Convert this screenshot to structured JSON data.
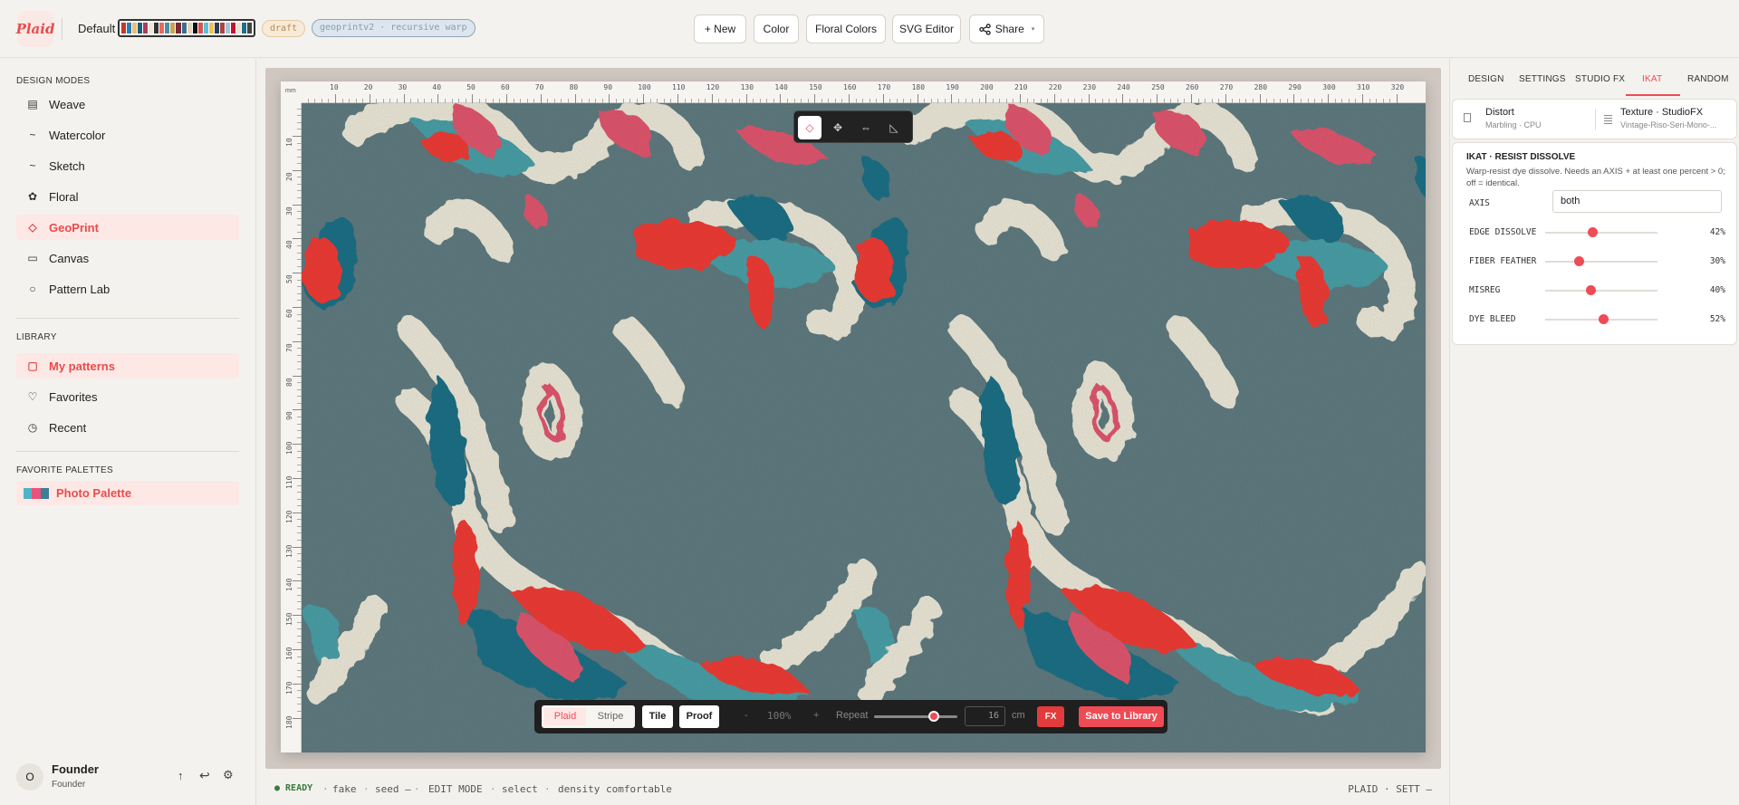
{
  "app": {
    "logo_text": "Plaid"
  },
  "topbar": {
    "project_name": "Default",
    "swatch_colors": [
      "#c0392b",
      "#2980b9",
      "#e8c07a",
      "#1a5e7a",
      "#b03a5b",
      "#f0e6d2",
      "#333333",
      "#e86a5a",
      "#4b8fa8",
      "#c7a35a",
      "#7a2a3a",
      "#3b6e8f",
      "#e5d3b3",
      "#111111",
      "#d9534f",
      "#5bc0de",
      "#f2c14e",
      "#2c3e50",
      "#a94442",
      "#9fc7d6",
      "#c8102e",
      "#eee3cf",
      "#1d6f8a",
      "#444444"
    ],
    "draft_badge": "draft",
    "engine_badge": "geoprintv2 · recursive warp",
    "buttons": {
      "new": "+ New",
      "color": "Color",
      "floral_colors": "Floral Colors",
      "svg_editor": "SVG Editor",
      "share": "Share"
    }
  },
  "sidebar": {
    "design_modes_title": "DESIGN MODES",
    "modes": [
      {
        "label": "Weave",
        "icon": "weave-icon"
      },
      {
        "label": "Watercolor",
        "icon": "watercolor-icon"
      },
      {
        "label": "Sketch",
        "icon": "sketch-icon"
      },
      {
        "label": "Floral",
        "icon": "floral-icon"
      },
      {
        "label": "GeoPrint",
        "icon": "geoprint-icon",
        "active": true
      },
      {
        "label": "Canvas",
        "icon": "canvas-icon"
      },
      {
        "label": "Pattern Lab",
        "icon": "pattern-lab-icon"
      }
    ],
    "library_title": "LIBRARY",
    "library": [
      {
        "label": "My patterns",
        "icon": "my-patterns-icon",
        "active": true
      },
      {
        "label": "Favorites",
        "icon": "heart-icon"
      },
      {
        "label": "Recent",
        "icon": "clock-icon"
      }
    ],
    "palettes_title": "FAVORITE PALETTES",
    "palettes": [
      {
        "label": "Photo Palette",
        "colors": [
          "#4fb3c9",
          "#e8547a",
          "#3d7e98"
        ]
      }
    ],
    "user": {
      "initial": "O",
      "name": "Founder",
      "role": "Founder"
    }
  },
  "ruler": {
    "unit": "mm",
    "top_ticks": [
      "10",
      "20",
      "30",
      "40",
      "50",
      "60",
      "70",
      "80",
      "90",
      "100",
      "110",
      "120",
      "130",
      "140",
      "150",
      "160",
      "170",
      "180",
      "190",
      "200",
      "210",
      "220",
      "230",
      "240",
      "250",
      "260",
      "270",
      "280",
      "290",
      "300",
      "310",
      "320"
    ],
    "left_ticks": [
      "10",
      "20",
      "30",
      "40",
      "50",
      "60",
      "70",
      "80",
      "90",
      "100",
      "110",
      "120",
      "130",
      "140",
      "150",
      "160",
      "170",
      "180"
    ]
  },
  "pattern_colors": {
    "ground": "#5f7b80",
    "cream": "#ece8d8",
    "teal": "#1f6f86",
    "aqua": "#4a9fa7",
    "pink": "#e0566e",
    "red": "#ef3b36"
  },
  "bottombar": {
    "plaid": "Plaid",
    "stripe": "Stripe",
    "tile": "Tile",
    "proof": "Proof",
    "minus": "-",
    "zoom": "100%",
    "plus": "+",
    "repeat_label": "Repeat",
    "repeat_fraction": 0.72,
    "repeat_value": "16",
    "unit": "cm",
    "fx": "FX",
    "save": "Save to Library"
  },
  "status": {
    "ready": "● READY",
    "s1": "·",
    "fake": "fake",
    "s2": "·",
    "seed": "seed –",
    "s3": "·",
    "edit_mode": "EDIT MODE",
    "s4": "·",
    "select": "select",
    "s5": "·",
    "density": "density comfortable",
    "right": "PLAID · SETT –"
  },
  "right_panel": {
    "tabs": [
      "DESIGN",
      "SETTINGS",
      "STUDIO FX",
      "IKAT",
      "RANDOM"
    ],
    "active_tab": "IKAT",
    "distort": {
      "title": "Distort",
      "sub": "Marbling · CPU"
    },
    "texture": {
      "title": "Texture · StudioFX",
      "sub": "Vintage-Riso-Seri-Mono-..."
    },
    "ikat": {
      "title": "IKAT · RESIST DISSOLVE",
      "desc": "Warp-resist dye dissolve. Needs an AXIS + at least one percent > 0; off = identical.",
      "axis_label": "AXIS",
      "axis_value": "both",
      "sliders": [
        {
          "label": "EDGE DISSOLVE",
          "value": "42%",
          "fraction": 0.42
        },
        {
          "label": "FIBER FEATHER",
          "value": "30%",
          "fraction": 0.3
        },
        {
          "label": "MISREG",
          "value": "40%",
          "fraction": 0.4
        },
        {
          "label": "DYE BLEED",
          "value": "52%",
          "fraction": 0.52
        }
      ]
    }
  }
}
